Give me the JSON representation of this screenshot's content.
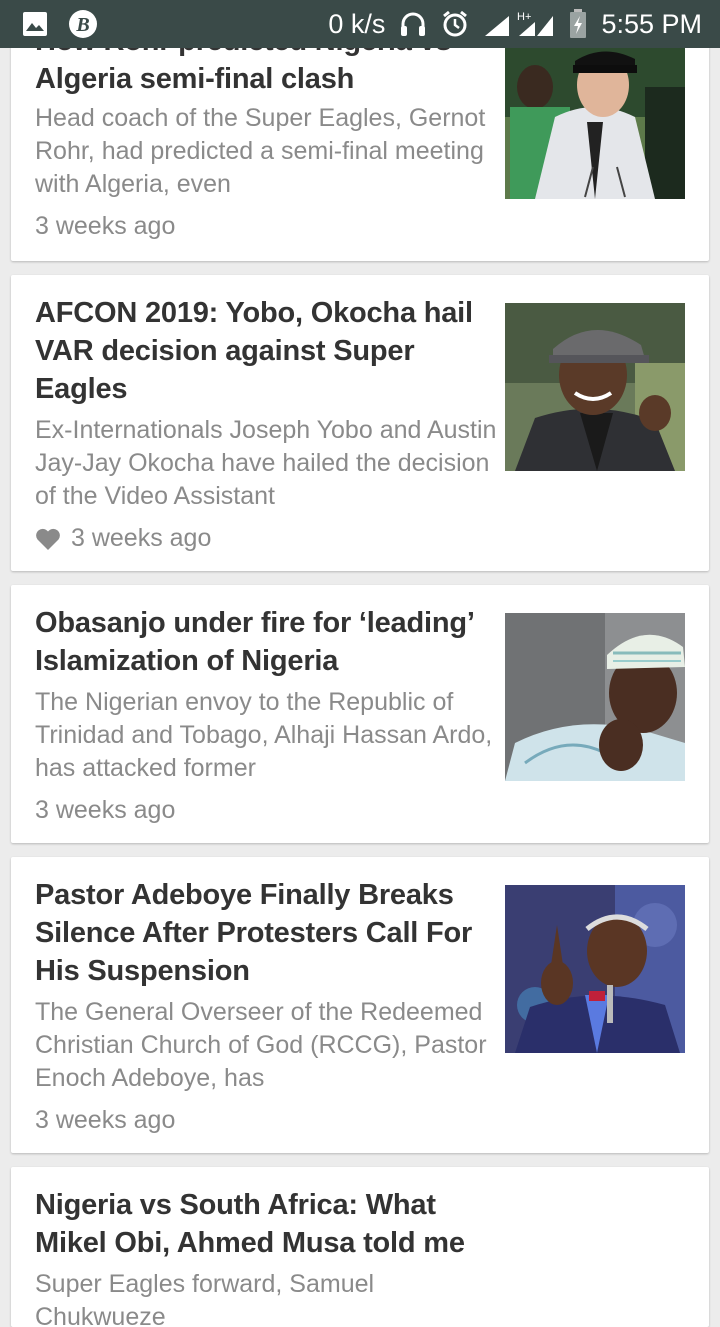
{
  "status_bar": {
    "net_speed": "0 k/s",
    "network_label": "H+",
    "time": "5:55 PM",
    "icons": [
      "image-icon",
      "b-app-icon",
      "headphones-icon",
      "alarm-icon",
      "signal-icon",
      "battery-icon"
    ]
  },
  "articles": [
    {
      "title": "How Rohr predicted Nigeria vs Algeria semi-final clash",
      "excerpt": "Head coach of the Super Eagles, Gernot Rohr, had predicted a semi-final meeting with Algeria, even",
      "time": "3 weeks ago",
      "liked": false,
      "thumb_icon": "coach-photo"
    },
    {
      "title": "AFCON 2019: Yobo, Okocha hail VAR decision against Super Eagles",
      "excerpt": "Ex-Internationals Joseph Yobo and Austin Jay-Jay Okocha have hailed the decision of the Video Assistant",
      "time": "3 weeks ago",
      "liked": true,
      "thumb_icon": "okocha-photo"
    },
    {
      "title": "Obasanjo under fire for ‘leading’ Islamization of Nigeria",
      "excerpt": "The Nigerian envoy to the Republic of Trinidad and Tobago, Alhaji Hassan Ardo, has attacked former",
      "time": "3 weeks ago",
      "liked": false,
      "thumb_icon": "obasanjo-photo"
    },
    {
      "title": "Pastor Adeboye Finally Breaks Silence After Protesters Call For His Suspension",
      "excerpt": "The General Overseer of the Redeemed Christian Church of God (RCCG), Pastor Enoch Adeboye, has",
      "time": "3 weeks ago",
      "liked": false,
      "thumb_icon": "adeboye-photo"
    },
    {
      "title": "Nigeria vs South Africa: What Mikel Obi, Ahmed Musa told me",
      "excerpt": "Super Eagles forward, Samuel Chukwueze",
      "time": "",
      "liked": false,
      "thumb_icon": ""
    }
  ],
  "colors": {
    "status_bar": "#3a4a48",
    "title": "#333333",
    "excerpt": "#8a8a8a",
    "background": "#ececec"
  }
}
